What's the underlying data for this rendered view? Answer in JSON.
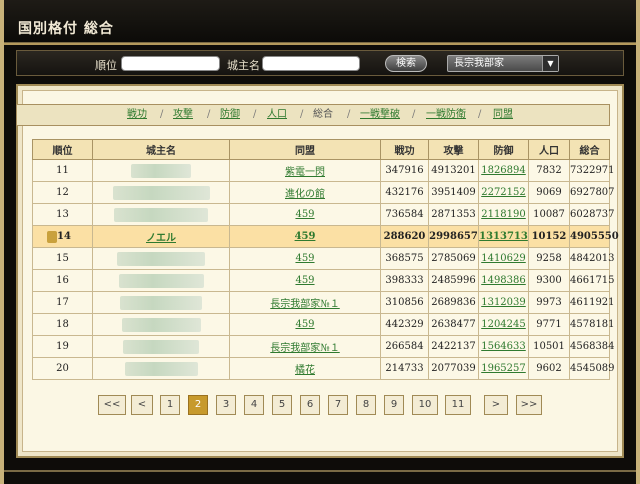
{
  "window": {
    "title": "国別格付 総合"
  },
  "search": {
    "rank_label": "順位",
    "rank_value": "",
    "castle_label": "城主名",
    "castle_value": "",
    "button_label": "検索",
    "country_selected": "長宗我部家"
  },
  "tabs": [
    {
      "label": "戦功",
      "active": false
    },
    {
      "label": "攻撃",
      "active": false
    },
    {
      "label": "防御",
      "active": false
    },
    {
      "label": "人口",
      "active": false
    },
    {
      "label": "総合",
      "active": true
    },
    {
      "label": "一戦撃破",
      "active": false
    },
    {
      "label": "一戦防衛",
      "active": false
    },
    {
      "label": "同盟",
      "active": false
    }
  ],
  "table": {
    "headers": [
      "順位",
      "城主名",
      "同盟",
      "戦功",
      "攻撃",
      "防御",
      "人口",
      "総合"
    ],
    "rows": [
      {
        "rank": "11",
        "name": "",
        "alliance": "紫電一閃",
        "senko": "347916",
        "attack": "4913201",
        "defense": "1826894",
        "population": "7832",
        "total": "7322971"
      },
      {
        "rank": "12",
        "name": "",
        "alliance": "進化の館",
        "senko": "432176",
        "attack": "3951409",
        "defense": "2272152",
        "population": "9069",
        "total": "6927807"
      },
      {
        "rank": "13",
        "name": "",
        "alliance": "459",
        "senko": "736584",
        "attack": "2871353",
        "defense": "2118190",
        "population": "10087",
        "total": "6028737"
      },
      {
        "rank": "14",
        "name": "ノエル",
        "alliance": "459",
        "senko": "288620",
        "attack": "2998657",
        "defense": "1313713",
        "population": "10152",
        "total": "4905550",
        "highlight": true
      },
      {
        "rank": "15",
        "name": "",
        "alliance": "459",
        "senko": "368575",
        "attack": "2785069",
        "defense": "1410629",
        "population": "9258",
        "total": "4842013"
      },
      {
        "rank": "16",
        "name": "",
        "alliance": "459",
        "senko": "398333",
        "attack": "2485996",
        "defense": "1498386",
        "population": "9300",
        "total": "4661715"
      },
      {
        "rank": "17",
        "name": "",
        "alliance": "長宗我部家№１",
        "senko": "310856",
        "attack": "2689836",
        "defense": "1312039",
        "population": "9973",
        "total": "4611921"
      },
      {
        "rank": "18",
        "name": "",
        "alliance": "459",
        "senko": "442329",
        "attack": "2638477",
        "defense": "1204245",
        "population": "9771",
        "total": "4578181"
      },
      {
        "rank": "19",
        "name": "",
        "alliance": "長宗我部家№１",
        "senko": "266584",
        "attack": "2422137",
        "defense": "1564633",
        "population": "10501",
        "total": "4568384"
      },
      {
        "rank": "20",
        "name": "",
        "alliance": "橘花",
        "senko": "214733",
        "attack": "2077039",
        "defense": "1965257",
        "population": "9602",
        "total": "4545089"
      }
    ]
  },
  "pager": {
    "first": "<<",
    "prev": "<",
    "pages": [
      "1",
      "2",
      "3",
      "4",
      "5",
      "6",
      "7",
      "8",
      "9",
      "10",
      "11"
    ],
    "current": "2",
    "next": ">",
    "last": ">>"
  }
}
